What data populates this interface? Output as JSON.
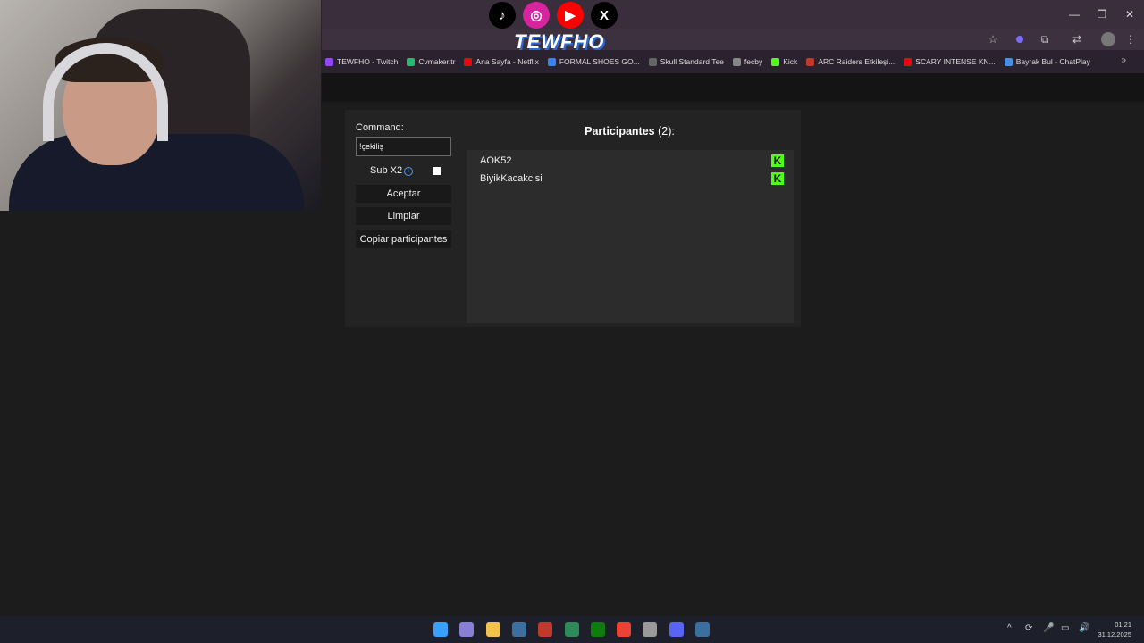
{
  "overlay": {
    "brand": "TEWFHO",
    "socials": [
      {
        "name": "tiktok",
        "glyph": "♪",
        "color": "#000000"
      },
      {
        "name": "instagram",
        "glyph": "◎",
        "color": "#d6249f"
      },
      {
        "name": "youtube",
        "glyph": "▶",
        "color": "#ff0000"
      },
      {
        "name": "x",
        "glyph": "X",
        "color": "#000000"
      }
    ]
  },
  "window": {
    "minimize": "—",
    "restore": "❐",
    "close": "✕"
  },
  "toolbar": {
    "star_icon": "☆",
    "extensions_icon": "⧉",
    "translate_icon": "⇄",
    "menu_icon": "⋮"
  },
  "bookmarks": [
    {
      "label": "TEWFHO - Twitch",
      "color": "#9146ff"
    },
    {
      "label": "Cvmaker.tr",
      "color": "#2bb673"
    },
    {
      "label": "Ana Sayfa - Netflix",
      "color": "#e50914"
    },
    {
      "label": "FORMAL SHOES GO...",
      "color": "#3b82f6"
    },
    {
      "label": "Skull Standard Tee",
      "color": "#666666"
    },
    {
      "label": "fecby",
      "color": "#888888"
    },
    {
      "label": "Kick",
      "color": "#53fc18"
    },
    {
      "label": "ARC Raiders Etkileşi...",
      "color": "#c0392b"
    },
    {
      "label": "SCARY INTENSE KN...",
      "color": "#e50914"
    },
    {
      "label": "Bayrak Bul - ChatPlay",
      "color": "#4a90e2"
    }
  ],
  "bookmarks_more": "»",
  "app": {
    "command_label": "Command:",
    "command_value": "!çekiliş",
    "sub_label": "Sub X2",
    "sub_checked": false,
    "accept_label": "Aceptar",
    "clear_label": "Limpiar",
    "copy_label": "Copiar participantes",
    "participants_title": "Participantes",
    "participants_count": "(2):",
    "participants": [
      {
        "name": "AOK52",
        "platform": "kick"
      },
      {
        "name": "BiyikKacakcisi",
        "platform": "kick"
      }
    ]
  },
  "taskbar": {
    "time": "01:21",
    "date": "31.12.2025",
    "apps": [
      {
        "name": "start",
        "color": "#3aa0ff"
      },
      {
        "name": "app-2",
        "color": "#8a7fd6"
      },
      {
        "name": "files",
        "color": "#f2c14e"
      },
      {
        "name": "steam",
        "color": "#3b6fa0"
      },
      {
        "name": "app-5",
        "color": "#c0392b"
      },
      {
        "name": "app-6",
        "color": "#2e8b57"
      },
      {
        "name": "xbox",
        "color": "#107c10"
      },
      {
        "name": "chrome",
        "color": "#ea4335"
      },
      {
        "name": "app-9",
        "color": "#9a9a9a"
      },
      {
        "name": "discord",
        "color": "#5865f2"
      },
      {
        "name": "steam-2",
        "color": "#3b6fa0"
      }
    ],
    "tray": [
      "^",
      "⟳",
      "🎤",
      "▭",
      "🔊"
    ]
  }
}
